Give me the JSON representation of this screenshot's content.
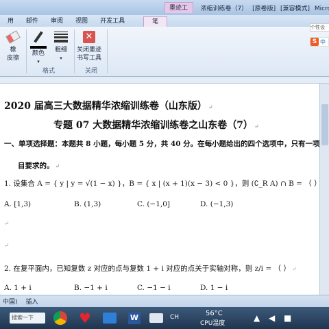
{
  "titlebar": {
    "context_tool": "墨迹工具",
    "doc_name": "浓缩训练卷（7）",
    "compat": "[原卷版]",
    "mode": "[兼容模式]",
    "app": "Microsoft Word"
  },
  "tabs": [
    "用",
    "邮件",
    "审阅",
    "视图",
    "开发工具",
    "笔"
  ],
  "ribbon": {
    "eraser": [
      "橡",
      "皮擦"
    ],
    "color": "颜色",
    "weight": "粗细",
    "format_group": "格式",
    "close_btn": [
      "关闭墨迹",
      "书写工具"
    ],
    "close_group": "关闭"
  },
  "doc": {
    "title1": "2020 届高三大数据精华浓缩训练卷（山东版）",
    "title2": "专题 07  大数据精华浓缩训练卷之山东卷（7）",
    "section1": "一、单项选择题：本题共 8 小题，每小题 5 分，共 40 分。在每小题给出的四个选项中，只有一项是符合题",
    "section1b": "目要求的。",
    "q1": "1. 设集合 A = { y | y = √(1 − x) }，B = { x | (x + 1)(x − 3) < 0 }，则 (∁_R A) ∩ B = （     ）",
    "q1_options": [
      "A.  [1,3)",
      "B.  (1,3)",
      "C.  (−1,0]",
      "D.  (−1,3)"
    ],
    "q2": "2. 在复平面内，已知复数 z 对应的点与复数 1 + i 对应的点关于实轴对称，则 z/i = （     ）",
    "q2_options": [
      "A.  1 + i",
      "B.  −1 + i",
      "C.  −1 − i",
      "D.  1 − i"
    ],
    "para_mark": "↵",
    "side_tip": "个性设",
    "sogou_text": "中"
  },
  "status": [
    "中国)",
    "插入"
  ],
  "taskbar": {
    "search": "搜索一下",
    "lang": "CH",
    "temp": "56°C",
    "temp_label": "CPU温度"
  }
}
